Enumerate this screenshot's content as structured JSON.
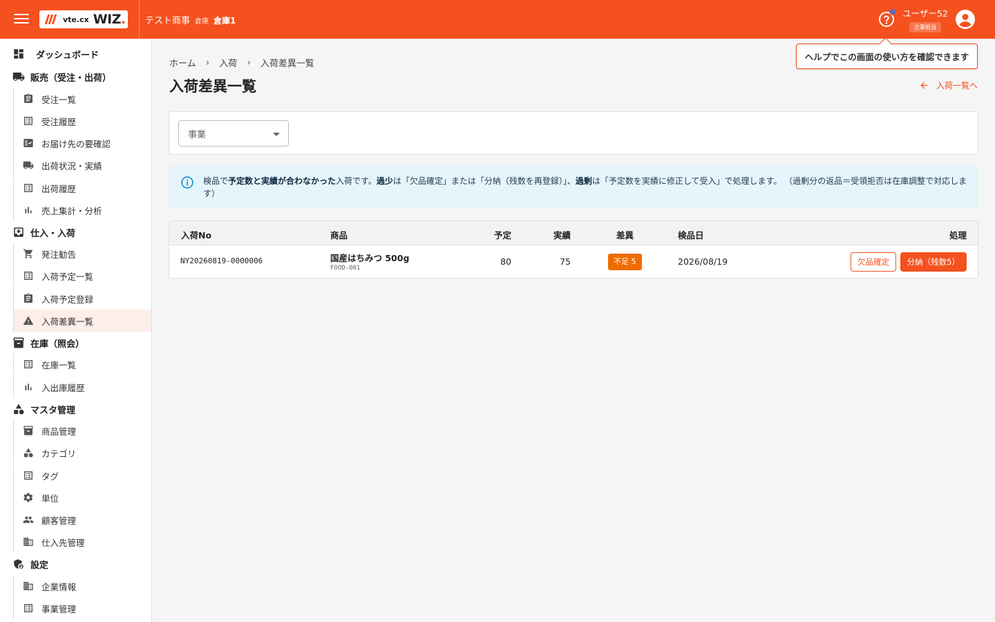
{
  "header": {
    "logo_vte": "vte.cx",
    "logo_wiz": "WIZ",
    "logo_dot": ".",
    "company_name": "テスト商事",
    "warehouse_label": "倉庫",
    "warehouse_name": "倉庫1",
    "user_name": "ユーザー52",
    "user_role": "企業担当",
    "brand_color": "#f4511e"
  },
  "tooltip": {
    "text": "ヘルプでこの画面の使い方を確認できます"
  },
  "sidebar": {
    "dashboard": "ダッシュボード",
    "sales": {
      "label": "販売（受注・出荷）",
      "items": [
        "受注一覧",
        "受注履歴",
        "お届け先の要確認",
        "出荷状況・実績",
        "出荷履歴",
        "売上集計・分析"
      ]
    },
    "purchase": {
      "label": "仕入・入荷",
      "items": [
        "発注勧告",
        "入荷予定一覧",
        "入荷予定登録",
        "入荷差異一覧"
      ]
    },
    "inventory": {
      "label": "在庫（照会）",
      "items": [
        "在庫一覧",
        "入出庫履歴"
      ]
    },
    "master": {
      "label": "マスタ管理",
      "items": [
        "商品管理",
        "カテゴリ",
        "タグ",
        "単位",
        "顧客管理",
        "仕入先管理"
      ]
    },
    "settings": {
      "label": "設定",
      "items": [
        "企業情報",
        "事業管理"
      ]
    },
    "active_item": "入荷差異一覧"
  },
  "breadcrumb": [
    "ホーム",
    "入荷",
    "入荷差異一覧"
  ],
  "page": {
    "title": "入荷差異一覧",
    "back_link": "入荷一覧へ"
  },
  "filter": {
    "business_placeholder": "事業"
  },
  "info": {
    "t1": "検品で",
    "b1": "予定数と実績が合わなかった",
    "t2": "入荷です。",
    "b2": "過少",
    "t3": "は「欠品確定」または「分納（残数を再登録）」、",
    "b3": "過剰",
    "t4": "は「予定数を実績に修正して受入」で処理します。 （過剰分の返品＝受領拒否は在庫調整で対応します）"
  },
  "table": {
    "headers": [
      "入荷No",
      "商品",
      "予定",
      "実績",
      "差異",
      "検品日",
      "処理"
    ],
    "rows": [
      {
        "no": "NY20260819-0000006",
        "product_name": "国産はちみつ 500g",
        "product_code": "FOOD-001",
        "planned": "80",
        "actual": "75",
        "diff": "不足 5",
        "inspected": "2026/08/19",
        "action_shortage": "欠品確定",
        "action_split": "分納（残数5）"
      }
    ]
  }
}
